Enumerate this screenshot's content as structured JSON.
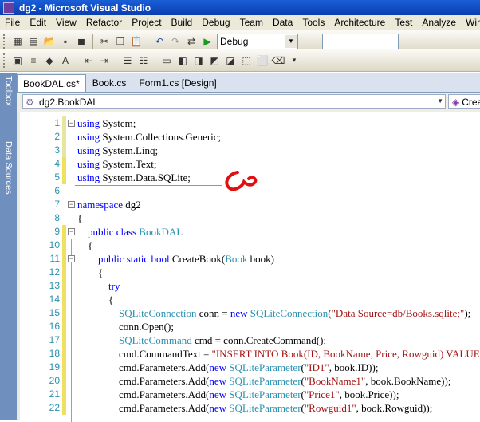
{
  "window": {
    "title": "dg2 - Microsoft Visual Studio"
  },
  "menu": [
    "File",
    "Edit",
    "View",
    "Refactor",
    "Project",
    "Build",
    "Debug",
    "Team",
    "Data",
    "Tools",
    "Architecture",
    "Test",
    "Analyze",
    "Window"
  ],
  "toolbar": {
    "configuration": "Debug",
    "icons1": [
      "new-project-icon",
      "add-item-icon",
      "open-icon",
      "save-icon",
      "save-all-icon",
      "cut-icon",
      "copy-icon",
      "paste-icon",
      "undo-icon",
      "redo-icon",
      "navigate-icon",
      "start-debugging-icon"
    ],
    "icons2": [
      "format-icon",
      "comment-icon",
      "uncomment-icon",
      "bookmark-icon"
    ]
  },
  "side_tabs": {
    "toolbox": "Toolbox",
    "data_sources": "Data Sources"
  },
  "tabs": [
    {
      "label": "BookDAL.cs*",
      "active": true
    },
    {
      "label": "Book.cs",
      "active": false
    },
    {
      "label": "Form1.cs [Design]",
      "active": false
    }
  ],
  "navigation": {
    "type_selector": "dg2.BookDAL",
    "member_selector": "Crea"
  },
  "code_lines": [
    {
      "num": "1",
      "fold": "−",
      "chg": "#e6e6a0",
      "parts": [
        {
          "t": "using",
          "c": "kw"
        },
        {
          "t": " System;"
        }
      ]
    },
    {
      "num": "2",
      "fold": "",
      "chg": "#e6e6a0",
      "parts": [
        {
          "t": "using",
          "c": "kw"
        },
        {
          "t": " System.Collections.Generic;"
        }
      ]
    },
    {
      "num": "3",
      "fold": "",
      "chg": "#e6e6a0",
      "parts": [
        {
          "t": "using",
          "c": "kw"
        },
        {
          "t": " System.Linq;"
        }
      ]
    },
    {
      "num": "4",
      "fold": "",
      "chg": "#f0e060",
      "parts": [
        {
          "t": "using",
          "c": "kw"
        },
        {
          "t": " System.Text;"
        }
      ]
    },
    {
      "num": "5",
      "fold": "",
      "chg": "#f0e060",
      "parts": [
        {
          "t": "using",
          "c": "kw"
        },
        {
          "t": " System.Data.SQLite;"
        }
      ]
    },
    {
      "num": "6",
      "fold": "",
      "chg": "",
      "parts": []
    },
    {
      "num": "7",
      "fold": "−",
      "chg": "",
      "parts": [
        {
          "t": "namespace",
          "c": "kw"
        },
        {
          "t": " dg2"
        }
      ]
    },
    {
      "num": "8",
      "fold": "",
      "chg": "",
      "parts": [
        {
          "t": "{"
        }
      ]
    },
    {
      "num": "9",
      "fold": "−",
      "chg": "#f0e060",
      "parts": [
        {
          "t": "    "
        },
        {
          "t": "public",
          "c": "kw"
        },
        {
          "t": " "
        },
        {
          "t": "class",
          "c": "kw"
        },
        {
          "t": " "
        },
        {
          "t": "BookDAL",
          "c": "ty"
        }
      ]
    },
    {
      "num": "10",
      "fold": "",
      "chg": "#f0e060",
      "parts": [
        {
          "t": "    {"
        }
      ]
    },
    {
      "num": "11",
      "fold": "−",
      "chg": "#f0e060",
      "parts": [
        {
          "t": "        "
        },
        {
          "t": "public",
          "c": "kw"
        },
        {
          "t": " "
        },
        {
          "t": "static",
          "c": "kw"
        },
        {
          "t": " "
        },
        {
          "t": "bool",
          "c": "kw"
        },
        {
          "t": " CreateBook("
        },
        {
          "t": "Book",
          "c": "ty"
        },
        {
          "t": " book)"
        }
      ]
    },
    {
      "num": "12",
      "fold": "",
      "chg": "#f0e060",
      "parts": [
        {
          "t": "        {"
        }
      ]
    },
    {
      "num": "13",
      "fold": "",
      "chg": "#f0e060",
      "parts": [
        {
          "t": "            "
        },
        {
          "t": "try",
          "c": "kw"
        }
      ]
    },
    {
      "num": "14",
      "fold": "",
      "chg": "#f0e060",
      "parts": [
        {
          "t": "            {"
        }
      ]
    },
    {
      "num": "15",
      "fold": "",
      "chg": "#f0e060",
      "parts": [
        {
          "t": "                "
        },
        {
          "t": "SQLiteConnection",
          "c": "ty"
        },
        {
          "t": " conn = "
        },
        {
          "t": "new",
          "c": "kw"
        },
        {
          "t": " "
        },
        {
          "t": "SQLiteConnection",
          "c": "ty"
        },
        {
          "t": "("
        },
        {
          "t": "\"Data Source=db/Books.sqlite;\"",
          "c": "str"
        },
        {
          "t": ");"
        }
      ]
    },
    {
      "num": "16",
      "fold": "",
      "chg": "#f0e060",
      "parts": [
        {
          "t": "                conn.Open();"
        }
      ]
    },
    {
      "num": "17",
      "fold": "",
      "chg": "#f0e060",
      "parts": [
        {
          "t": "                "
        },
        {
          "t": "SQLiteCommand",
          "c": "ty"
        },
        {
          "t": " cmd = conn.CreateCommand();"
        }
      ]
    },
    {
      "num": "18",
      "fold": "",
      "chg": "#f0e060",
      "parts": [
        {
          "t": "                cmd.CommandText = "
        },
        {
          "t": "\"INSERT INTO Book(ID, BookName, Price, Rowguid) VALUES(@",
          "c": "str"
        }
      ]
    },
    {
      "num": "19",
      "fold": "",
      "chg": "#f0e060",
      "parts": [
        {
          "t": "                cmd.Parameters.Add("
        },
        {
          "t": "new",
          "c": "kw"
        },
        {
          "t": " "
        },
        {
          "t": "SQLiteParameter",
          "c": "ty"
        },
        {
          "t": "("
        },
        {
          "t": "\"ID1\"",
          "c": "str"
        },
        {
          "t": ", book.ID));"
        }
      ]
    },
    {
      "num": "20",
      "fold": "",
      "chg": "#f0e060",
      "parts": [
        {
          "t": "                cmd.Parameters.Add("
        },
        {
          "t": "new",
          "c": "kw"
        },
        {
          "t": " "
        },
        {
          "t": "SQLiteParameter",
          "c": "ty"
        },
        {
          "t": "("
        },
        {
          "t": "\"BookName1\"",
          "c": "str"
        },
        {
          "t": ", book.BookName));"
        }
      ]
    },
    {
      "num": "21",
      "fold": "",
      "chg": "#f0e060",
      "parts": [
        {
          "t": "                cmd.Parameters.Add("
        },
        {
          "t": "new",
          "c": "kw"
        },
        {
          "t": " "
        },
        {
          "t": "SQLiteParameter",
          "c": "ty"
        },
        {
          "t": "("
        },
        {
          "t": "\"Price1\"",
          "c": "str"
        },
        {
          "t": ", book.Price));"
        }
      ]
    },
    {
      "num": "22",
      "fold": "",
      "chg": "#f0e060",
      "parts": [
        {
          "t": "                cmd.Parameters.Add("
        },
        {
          "t": "new",
          "c": "kw"
        },
        {
          "t": " "
        },
        {
          "t": "SQLiteParameter",
          "c": "ty"
        },
        {
          "t": "("
        },
        {
          "t": "\"Rowguid1\"",
          "c": "str"
        },
        {
          "t": ", book.Rowguid));"
        }
      ]
    }
  ]
}
